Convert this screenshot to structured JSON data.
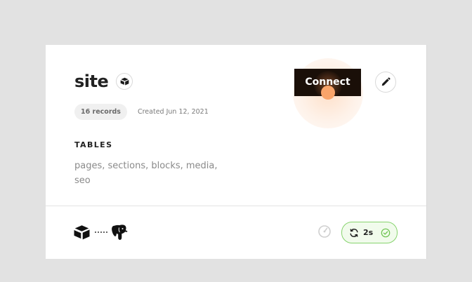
{
  "card": {
    "title": "site",
    "records_label": "16 records",
    "created_label": "Created Jun 12, 2021",
    "tables_heading": "TABLES",
    "tables_list": "pages, sections, blocks, media, seo",
    "connect_label": "Connect"
  },
  "footer": {
    "sync_label": "2s",
    "source_icon": "airtable-icon",
    "destination_icon": "postgres-elephant-icon"
  },
  "colors": {
    "accent_orange": "#f9a46a",
    "button_dark": "#1a0f08",
    "success_green": "#86d36d"
  }
}
